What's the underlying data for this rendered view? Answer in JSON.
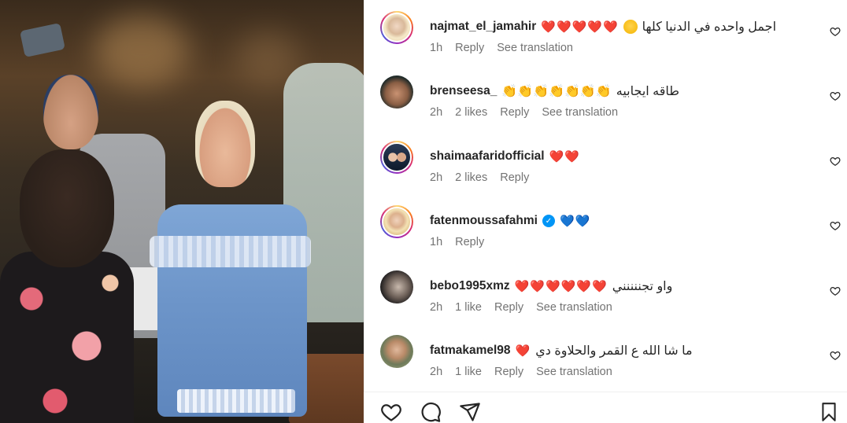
{
  "post": {
    "media_alt": ""
  },
  "comments": [
    {
      "username": "najmat_el_jamahir",
      "text": "اجمل واحده في الدنيا كلها",
      "emoji": "❤️❤️❤️❤️❤️",
      "face_emoji": "smiling-face-with-hearts",
      "time": "1h",
      "likes": "",
      "reply_label": "Reply",
      "translate_label": "See translation",
      "verified": false
    },
    {
      "username": "brenseesa_",
      "text": "طاقه ايجابيه",
      "emoji": "👏👏👏👏👏👏👏",
      "time": "2h",
      "likes": "2 likes",
      "reply_label": "Reply",
      "translate_label": "See translation",
      "verified": false
    },
    {
      "username": "shaimaafaridofficial",
      "text": "",
      "emoji": "❤️❤️",
      "time": "2h",
      "likes": "2 likes",
      "reply_label": "Reply",
      "translate_label": "",
      "verified": false
    },
    {
      "username": "fatenmoussafahmi",
      "text": "",
      "emoji": "💙💙",
      "time": "1h",
      "likes": "",
      "reply_label": "Reply",
      "translate_label": "",
      "verified": true
    },
    {
      "username": "bebo1995xmz",
      "text": "واو تجننننني",
      "emoji": "❤️❤️❤️❤️❤️❤️",
      "time": "2h",
      "likes": "1 like",
      "reply_label": "Reply",
      "translate_label": "See translation",
      "verified": false
    },
    {
      "username": "fatmakamel98",
      "text": "ما شا الله ع القمر والحلاوة دي",
      "emoji": "❤️",
      "time": "2h",
      "likes": "1 like",
      "reply_label": "Reply",
      "translate_label": "See translation",
      "verified": false
    }
  ],
  "colors": {
    "heart_red": "#ed1c3a",
    "heart_blue": "#0a84ff",
    "meta_gray": "#737373",
    "text": "#262626",
    "verified_blue": "#0095f6"
  },
  "actions": {
    "icons": [
      "heart-outline-icon",
      "comment-icon",
      "share-icon",
      "bookmark-icon"
    ]
  }
}
